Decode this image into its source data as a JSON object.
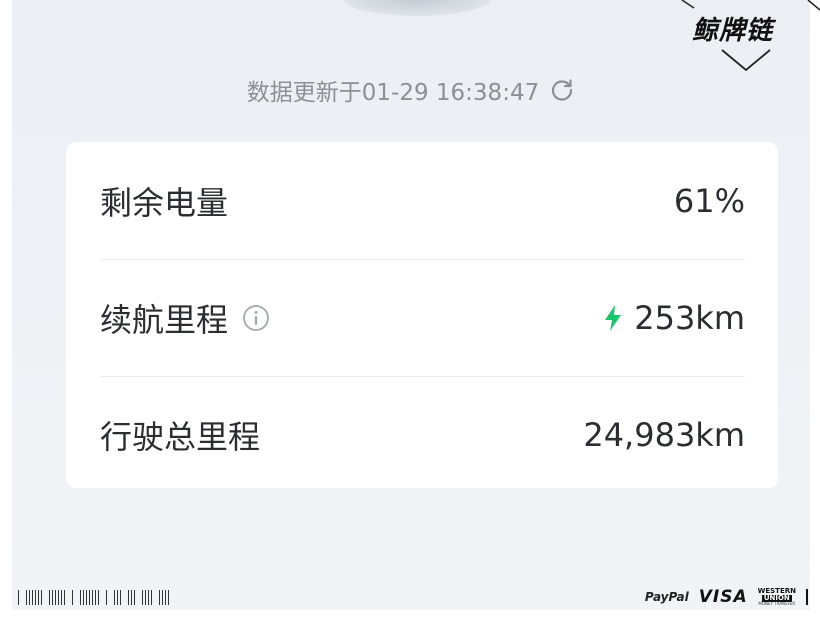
{
  "header": {
    "update_text": "数据更新于01-29 16:38:47",
    "refresh_icon": "refresh-icon"
  },
  "stats": {
    "rows": [
      {
        "label": "剩余电量",
        "value": "61%"
      },
      {
        "label": "续航里程",
        "value": "253km",
        "info_icon": "info-icon",
        "value_icon": "lightning-bolt-icon"
      },
      {
        "label": "行驶总里程",
        "value": "24,983km"
      }
    ]
  },
  "watermark": {
    "logo": "鲸牌链"
  },
  "footer": {
    "paypal": "PayPal",
    "visa": "VISA",
    "wu_top": "WESTERN",
    "wu_mid": "UNION",
    "wu_bottom": "MONEY TRANSFER"
  },
  "colors": {
    "accent_green": "#19c66a",
    "text_primary": "#2b2d31",
    "text_secondary": "#8c9096",
    "background": "#eef1f5",
    "card": "#ffffff"
  }
}
